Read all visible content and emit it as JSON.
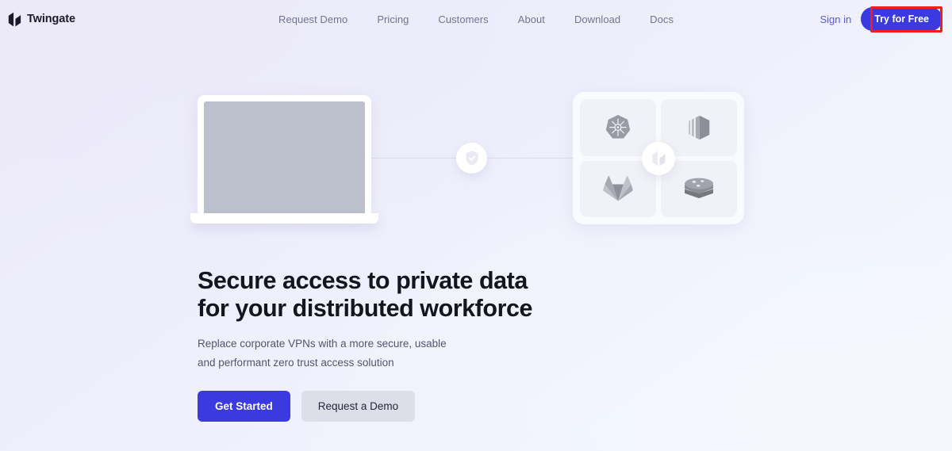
{
  "brand": {
    "name": "Twingate",
    "logo_icon": "twingate-logo-icon"
  },
  "nav": {
    "links": [
      {
        "label": "Request Demo"
      },
      {
        "label": "Pricing"
      },
      {
        "label": "Customers"
      },
      {
        "label": "About"
      },
      {
        "label": "Download"
      },
      {
        "label": "Docs"
      }
    ],
    "signin_label": "Sign in",
    "cta_label": "Try for Free",
    "cta_color": "#3a3ae0",
    "highlight_color": "#f51b1b"
  },
  "hero": {
    "headline_line1": "Secure access to private data",
    "headline_line2": "for your distributed workforce",
    "subhead_line1": "Replace corporate VPNs with a more secure, usable and",
    "subhead_line2": "performant zero trust access solution",
    "primary_cta": "Get Started",
    "secondary_cta": "Request a Demo"
  },
  "illustration": {
    "laptop_icon": "laptop-device",
    "shield_icon": "shield-check-icon",
    "center_icon": "twingate-logo-icon",
    "tiles": [
      {
        "icon": "kubernetes-icon"
      },
      {
        "icon": "aws-icon"
      },
      {
        "icon": "gitlab-icon"
      },
      {
        "icon": "redis-icon"
      }
    ]
  },
  "colors": {
    "accent": "#3a3ae0",
    "text_dark": "#15151f",
    "text_muted": "#54546d",
    "nav_muted": "#737391",
    "laptop_screen": "#bcc0cc"
  }
}
